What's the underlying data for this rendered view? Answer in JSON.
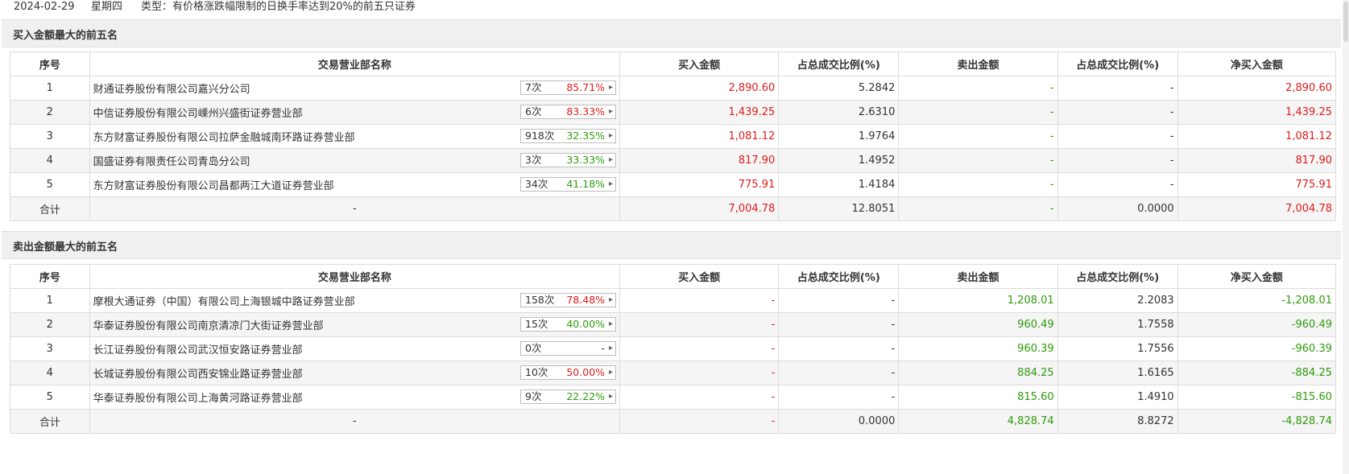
{
  "header": {
    "date": "2024-02-29",
    "weekday": "星期四",
    "type": "类型：有价格涨跌幅限制的日换手率达到20%的前五只证券"
  },
  "columns": [
    "序号",
    "交易营业部名称",
    "买入金额",
    "占总成交比例(%)",
    "卖出金额",
    "占总成交比例(%)",
    "净买入金额"
  ],
  "buy_section": {
    "title": "买入金额最大的前五名",
    "rows": [
      {
        "no": "1",
        "name": "财通证券股份有限公司嘉兴分公司",
        "times": "7次",
        "pct": "85.71%",
        "pct_color": "red",
        "buy": "2,890.60",
        "buy_ratio": "5.2842",
        "sell": "-",
        "sell_ratio": "-",
        "net": "2,890.60",
        "net_color": "red"
      },
      {
        "no": "2",
        "name": "中信证券股份有限公司嵊州兴盛街证券营业部",
        "times": "6次",
        "pct": "83.33%",
        "pct_color": "red",
        "buy": "1,439.25",
        "buy_ratio": "2.6310",
        "sell": "-",
        "sell_ratio": "-",
        "net": "1,439.25",
        "net_color": "red"
      },
      {
        "no": "3",
        "name": "东方财富证券股份有限公司拉萨金融城南环路证券营业部",
        "times": "918次",
        "pct": "32.35%",
        "pct_color": "green",
        "buy": "1,081.12",
        "buy_ratio": "1.9764",
        "sell": "-",
        "sell_ratio": "-",
        "net": "1,081.12",
        "net_color": "red"
      },
      {
        "no": "4",
        "name": "国盛证券有限责任公司青岛分公司",
        "times": "3次",
        "pct": "33.33%",
        "pct_color": "green",
        "buy": "817.90",
        "buy_ratio": "1.4952",
        "sell": "-",
        "sell_ratio": "-",
        "net": "817.90",
        "net_color": "red"
      },
      {
        "no": "5",
        "name": "东方财富证券股份有限公司昌都两江大道证券营业部",
        "times": "34次",
        "pct": "41.18%",
        "pct_color": "green",
        "buy": "775.91",
        "buy_ratio": "1.4184",
        "sell": "-",
        "sell_ratio": "-",
        "net": "775.91",
        "net_color": "red"
      }
    ],
    "total": {
      "label": "合计",
      "name": "-",
      "buy": "7,004.78",
      "buy_ratio": "12.8051",
      "sell": "-",
      "sell_ratio": "0.0000",
      "net": "7,004.78",
      "net_color": "red"
    }
  },
  "sell_section": {
    "title": "卖出金额最大的前五名",
    "rows": [
      {
        "no": "1",
        "name": "摩根大通证券（中国）有限公司上海银城中路证券营业部",
        "times": "158次",
        "pct": "78.48%",
        "pct_color": "red",
        "buy": "-",
        "buy_ratio": "-",
        "sell": "1,208.01",
        "sell_ratio": "2.2083",
        "net": "-1,208.01",
        "net_color": "green"
      },
      {
        "no": "2",
        "name": "华泰证券股份有限公司南京清凉门大街证券营业部",
        "times": "15次",
        "pct": "40.00%",
        "pct_color": "green",
        "buy": "-",
        "buy_ratio": "-",
        "sell": "960.49",
        "sell_ratio": "1.7558",
        "net": "-960.49",
        "net_color": "green"
      },
      {
        "no": "3",
        "name": "长江证券股份有限公司武汉恒安路证券营业部",
        "times": "0次",
        "pct": "-",
        "pct_color": "none",
        "buy": "-",
        "buy_ratio": "-",
        "sell": "960.39",
        "sell_ratio": "1.7556",
        "net": "-960.39",
        "net_color": "green"
      },
      {
        "no": "4",
        "name": "长城证券股份有限公司西安锦业路证券营业部",
        "times": "10次",
        "pct": "50.00%",
        "pct_color": "red",
        "buy": "-",
        "buy_ratio": "-",
        "sell": "884.25",
        "sell_ratio": "1.6165",
        "net": "-884.25",
        "net_color": "green"
      },
      {
        "no": "5",
        "name": "华泰证券股份有限公司上海黄河路证券营业部",
        "times": "9次",
        "pct": "22.22%",
        "pct_color": "green",
        "buy": "-",
        "buy_ratio": "-",
        "sell": "815.60",
        "sell_ratio": "1.4910",
        "net": "-815.60",
        "net_color": "green"
      }
    ],
    "total": {
      "label": "合计",
      "name": "-",
      "buy": "-",
      "buy_ratio": "0.0000",
      "sell": "4,828.74",
      "sell_ratio": "8.8272",
      "net": "-4,828.74",
      "net_color": "green"
    }
  },
  "colors": {
    "red": "#e01b1b",
    "green": "#2e9b0c"
  },
  "icons": {
    "badge_arrow": "chevron-right-icon"
  }
}
